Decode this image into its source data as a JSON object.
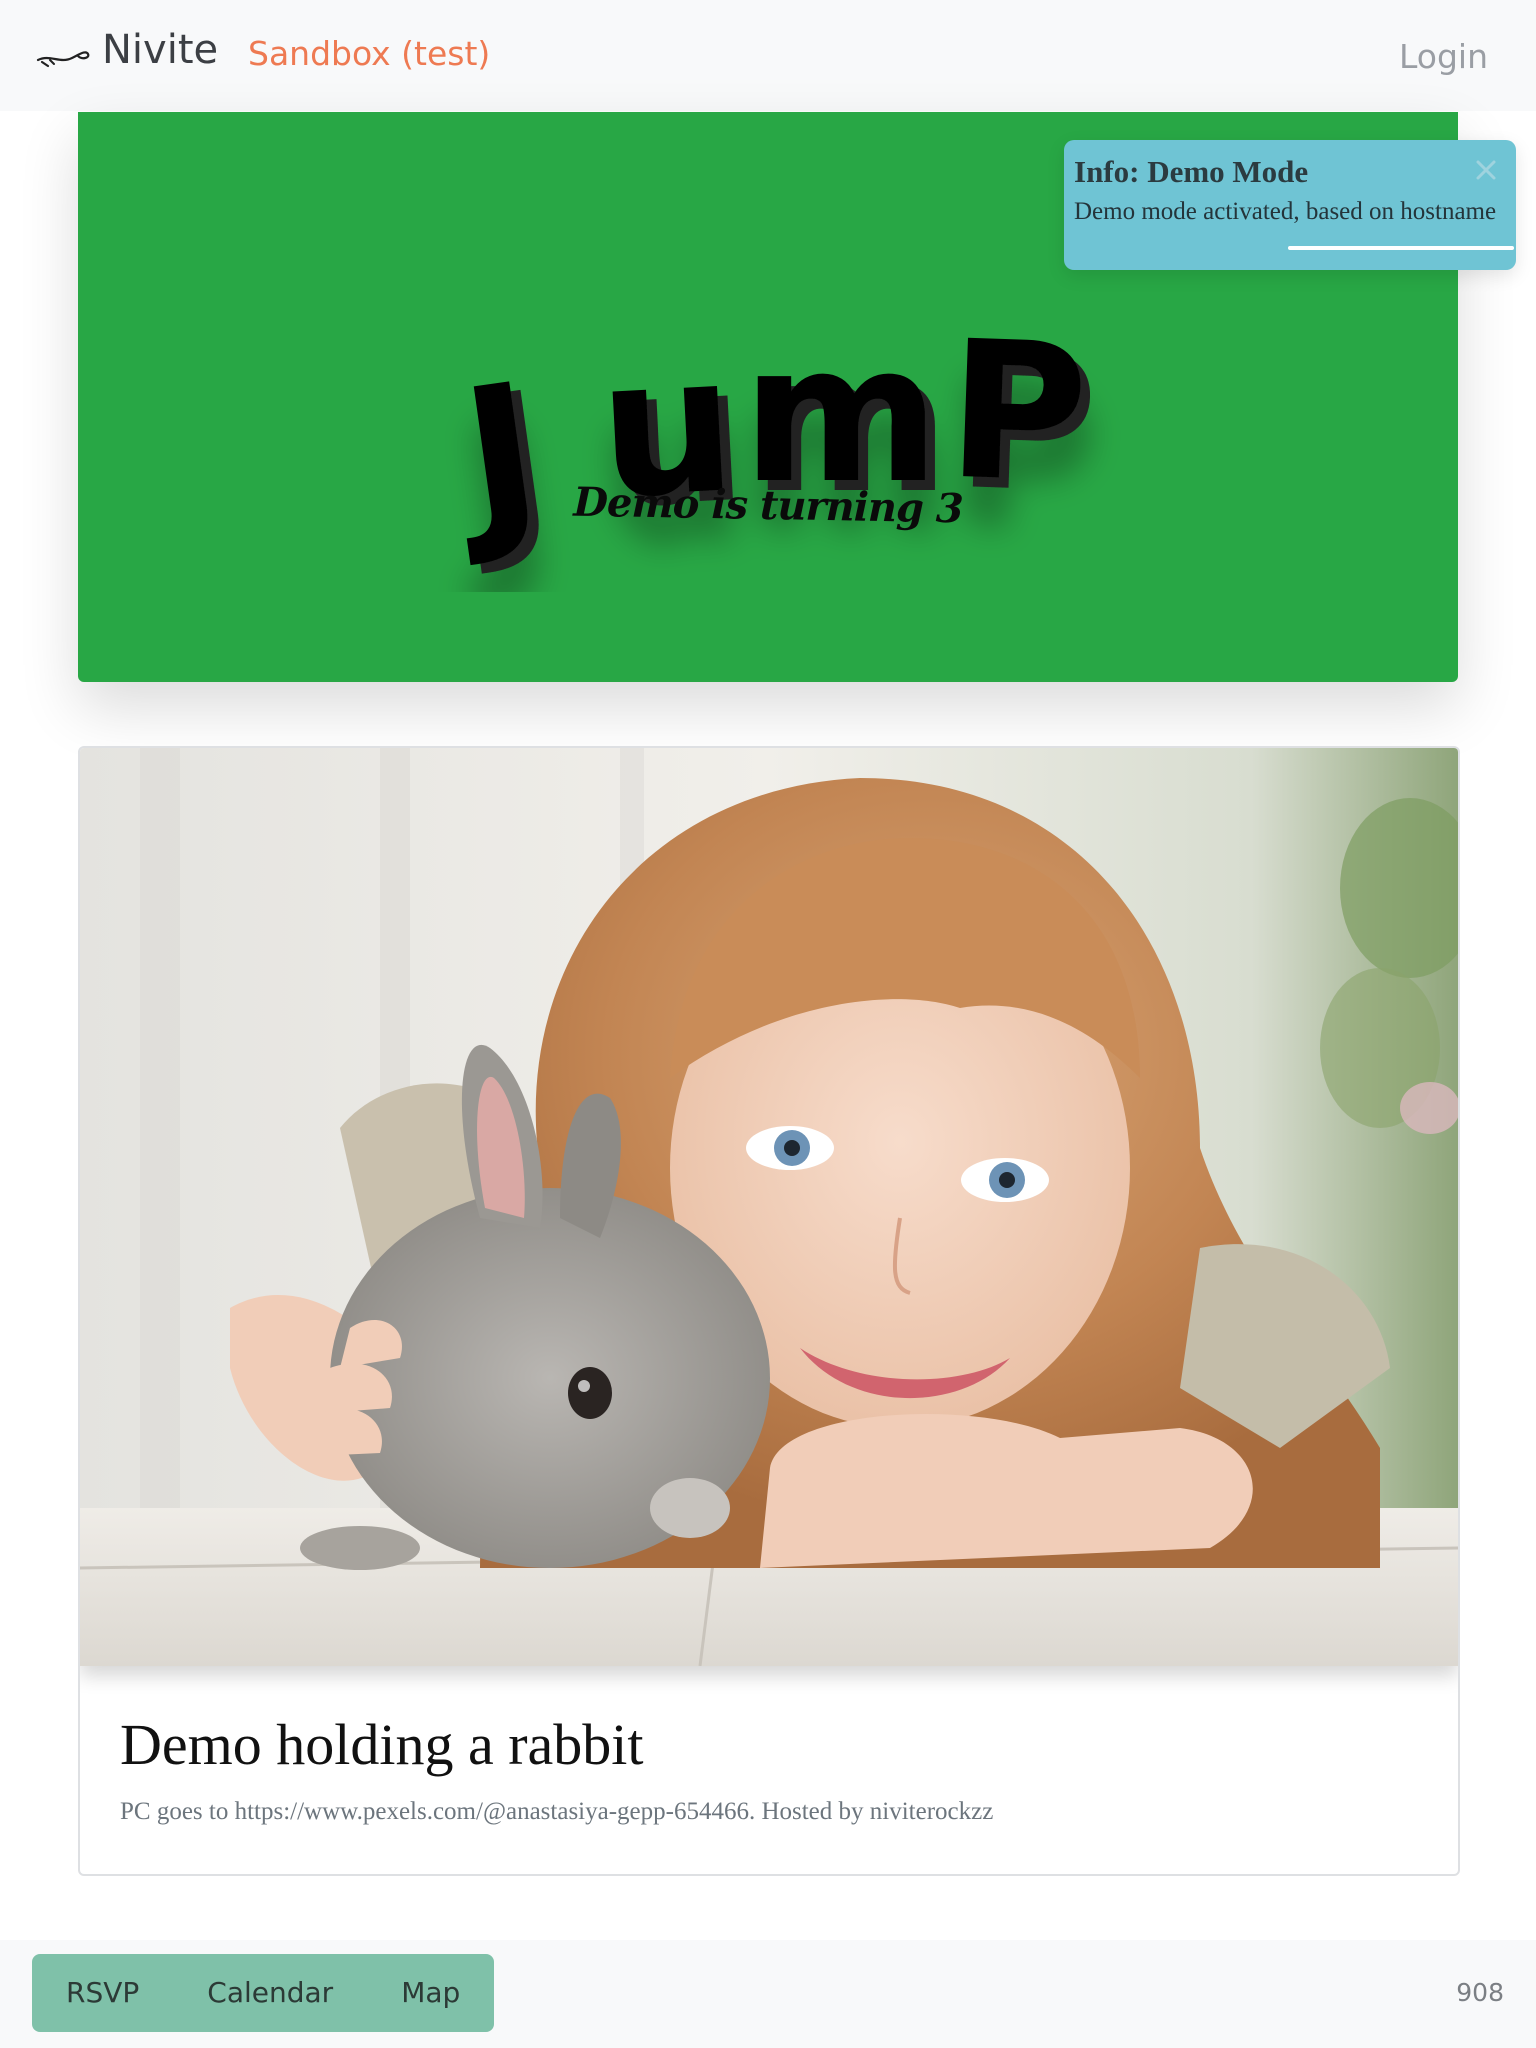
{
  "navbar": {
    "brand_icon": "fountain-pen-logo-icon",
    "brand_name": "Nivite",
    "environment_label": "Sandbox (test)",
    "login_label": "Login"
  },
  "hero": {
    "title": "JUMP",
    "subtitle": "Demo is turning 3",
    "background_color": "#28a745"
  },
  "toast": {
    "title": "Info: Demo Mode",
    "message": "Demo mode activated, based on hostname",
    "close_icon": "close-icon",
    "progress": 0.5,
    "background_color": "#6fc4d4"
  },
  "card": {
    "image_description": "photo-girl-with-rabbit",
    "title": "Demo holding a rabbit",
    "text": "PC goes to https://www.pexels.com/@anastasiya-gepp-654466. Hosted by niviterockzz"
  },
  "footer": {
    "nav": [
      "RSVP",
      "Calendar",
      "Map"
    ],
    "count": "908"
  },
  "colors": {
    "accent_orange": "#ee7a52",
    "footer_green": "#7fc1a9",
    "navbar_bg": "#f8f9fa"
  }
}
